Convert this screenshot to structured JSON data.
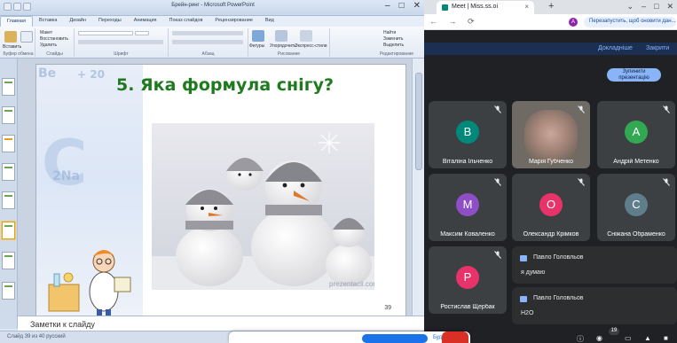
{
  "powerpoint": {
    "window_title": "Брейн-ринг - Microsoft PowerPoint",
    "window_controls": [
      "–",
      "□",
      "✕"
    ],
    "tabs": [
      "Главная",
      "Вставка",
      "Дизайн",
      "Переходы",
      "Анимация",
      "Показ слайдов",
      "Рецензирование",
      "Вид"
    ],
    "ribbon": {
      "groups": [
        {
          "label": "Буфер обмена",
          "items": [
            "Вставить",
            "Создать слайд"
          ]
        },
        {
          "label": "Слайды",
          "items": [
            "Макет",
            "Восстановить",
            "Удалить"
          ]
        },
        {
          "label": "Шрифт",
          "items": []
        },
        {
          "label": "Абзац",
          "items": []
        },
        {
          "label": "Рисование",
          "items": [
            "Фигуры",
            "Упорядочить",
            "Экспресс-стили"
          ]
        },
        {
          "label": "Редактирование",
          "items": [
            "Найти",
            "Заменить",
            "Выделить"
          ]
        }
      ]
    },
    "slide": {
      "title": "5. Яка формула снігу?",
      "chem_text_1": "Be",
      "chem_text_2": "+ 20",
      "chem_text_3": "C",
      "chem_text_4": "2Na",
      "watermark": "prezentacii.com",
      "number": "39"
    },
    "notes_placeholder": "Заметки к слайду",
    "status_text": "Слайд 39 из 40   русский"
  },
  "chrome": {
    "tab_title": "Meet | Miss.ss.oi",
    "new_tab": "+",
    "window_controls": [
      "⌄",
      "–",
      "□",
      "✕"
    ],
    "nav_icons": "← → ⟳",
    "profile_letter": "А",
    "update_text": "Перезапустить, щоб оновити дан..."
  },
  "meet": {
    "top_links": [
      "Докладніше",
      "Закрити"
    ],
    "stop_presenting": "Зупинити презентацію",
    "participants": [
      {
        "name": "Віталіна Ільченко",
        "initial": "В",
        "color": "#00897b",
        "has_camera": false
      },
      {
        "name": "Марія Губченко",
        "initial": "",
        "color": "#6f6a64",
        "has_camera": true
      },
      {
        "name": "Андрій Метенко",
        "initial": "А",
        "color": "#33a852",
        "has_camera": false
      },
      {
        "name": "Максим Коваленко",
        "initial": "М",
        "color": "#8e4ec6",
        "has_camera": false
      },
      {
        "name": "Олександр Крімков",
        "initial": "О",
        "color": "#e8336a",
        "has_camera": false
      },
      {
        "name": "Сніжана Обраменко",
        "initial": "С",
        "color": "#607d8b",
        "has_camera": false
      },
      {
        "name": "Ростислав Щербак",
        "initial": "Р",
        "color": "#e8336a",
        "has_camera": false
      }
    ],
    "chat_messages": [
      {
        "sender": "Павло Головльов",
        "text": "я думаю"
      },
      {
        "sender": "Павло Головльов",
        "text": "H2O"
      }
    ],
    "participants_count": "19"
  },
  "popup": {
    "secondary_button": "Буде..."
  }
}
